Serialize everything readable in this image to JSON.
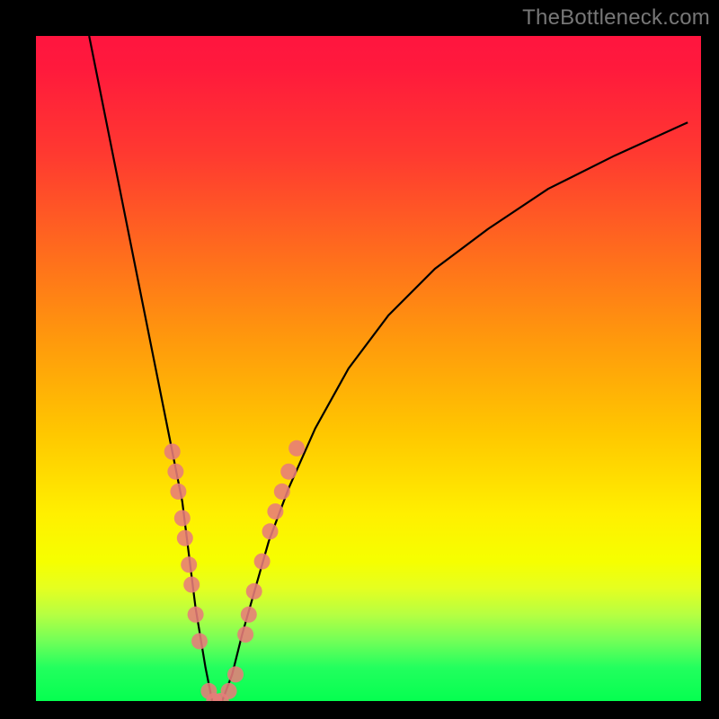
{
  "watermark": "TheBottleneck.com",
  "colors": {
    "frame": "#000000",
    "gradient_stops": [
      "#ff153f",
      "#ff3a30",
      "#ff6a1e",
      "#ff9a0c",
      "#ffc800",
      "#fff000",
      "#e5ff20",
      "#71ff58",
      "#05ff50"
    ],
    "curve": "#000000",
    "marker_fill": "#e77c7a",
    "marker_fill_alpha": 0.88,
    "watermark_text": "#777777"
  },
  "chart_data": {
    "type": "line",
    "title": "",
    "xlabel": "",
    "ylabel": "",
    "xlim": [
      0,
      100
    ],
    "ylim": [
      0,
      100
    ],
    "notes": "Asymmetric V-shaped bottleneck curve. Steep left arm, shallower right arm. Minimum near x≈26. No axis ticks/labels shown.",
    "series": [
      {
        "name": "bottleneck-curve",
        "x_norm": [
          0.08,
          0.1,
          0.12,
          0.14,
          0.16,
          0.18,
          0.2,
          0.22,
          0.23,
          0.24,
          0.255,
          0.265,
          0.28,
          0.295,
          0.31,
          0.33,
          0.35,
          0.38,
          0.42,
          0.47,
          0.53,
          0.6,
          0.68,
          0.77,
          0.87,
          0.98
        ],
        "y_norm": [
          1.0,
          0.9,
          0.8,
          0.7,
          0.6,
          0.5,
          0.4,
          0.3,
          0.22,
          0.14,
          0.05,
          0.0,
          0.0,
          0.04,
          0.1,
          0.17,
          0.24,
          0.32,
          0.41,
          0.5,
          0.58,
          0.65,
          0.71,
          0.77,
          0.82,
          0.87
        ]
      }
    ],
    "markers": {
      "name": "sample-points",
      "points_norm": [
        [
          0.205,
          0.375
        ],
        [
          0.21,
          0.345
        ],
        [
          0.214,
          0.315
        ],
        [
          0.22,
          0.275
        ],
        [
          0.224,
          0.245
        ],
        [
          0.23,
          0.205
        ],
        [
          0.234,
          0.175
        ],
        [
          0.24,
          0.13
        ],
        [
          0.246,
          0.09
        ],
        [
          0.26,
          0.015
        ],
        [
          0.268,
          0.0
        ],
        [
          0.278,
          0.0
        ],
        [
          0.29,
          0.015
        ],
        [
          0.3,
          0.04
        ],
        [
          0.315,
          0.1
        ],
        [
          0.32,
          0.13
        ],
        [
          0.328,
          0.165
        ],
        [
          0.34,
          0.21
        ],
        [
          0.352,
          0.255
        ],
        [
          0.36,
          0.285
        ],
        [
          0.37,
          0.315
        ],
        [
          0.38,
          0.345
        ],
        [
          0.392,
          0.38
        ]
      ]
    }
  }
}
